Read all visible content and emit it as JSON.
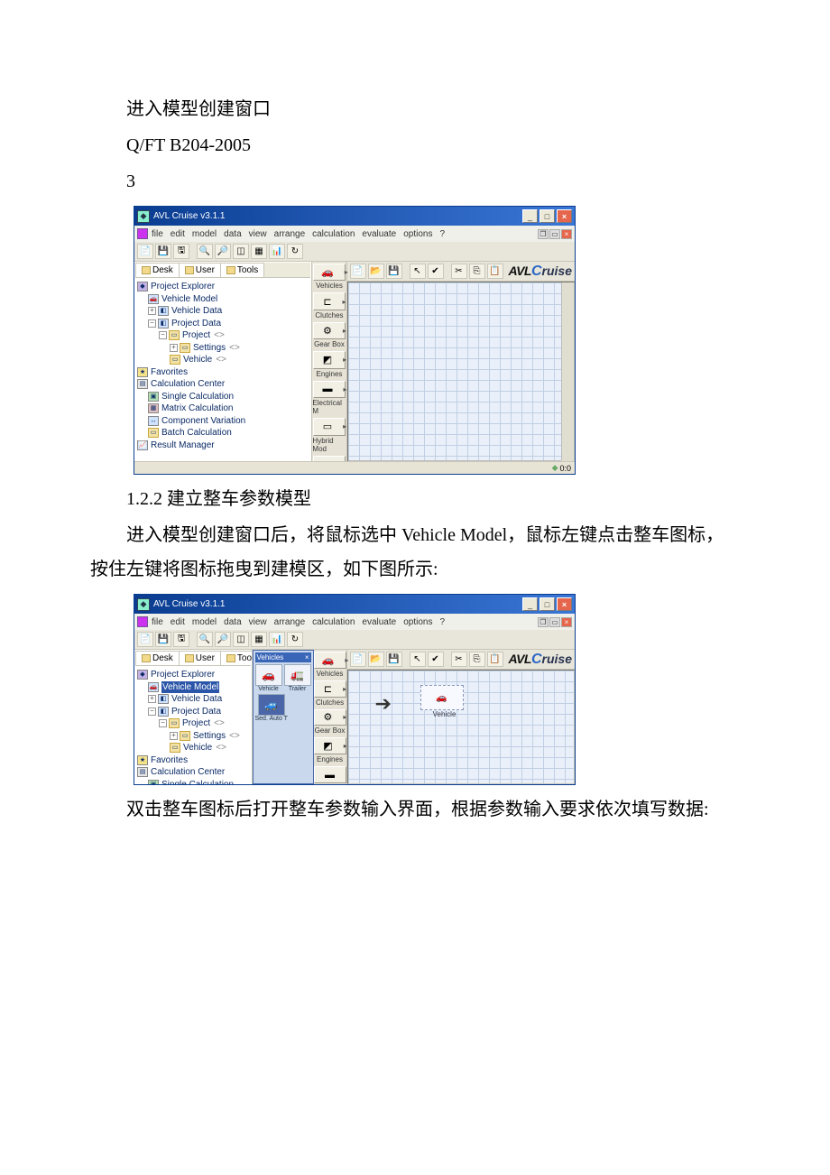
{
  "para1": "进入模型创建窗口",
  "para2": "Q/FT B204-2005",
  "para3": "3",
  "para4": "1.2.2 建立整车参数模型",
  "para5": "进入模型创建窗口后，将鼠标选中 Vehicle Model，鼠标左键点击整车图标，按住左键将图标拖曳到建模区，如下图所示:",
  "para6": "双击整车图标后打开整车参数输入界面，根据参数输入要求依次填写数据:",
  "sc1": {
    "title": "AVL Cruise v3.1.1",
    "menu": [
      "file",
      "edit",
      "model",
      "data",
      "view",
      "arrange",
      "calculation",
      "evaluate",
      "options",
      "?"
    ],
    "tabs": [
      "Desk",
      "User",
      "Tools"
    ],
    "tree": {
      "root": "Project Explorer",
      "vehicle_model": "Vehicle Model",
      "vehicle_data": "Vehicle Data",
      "project_data": "Project Data",
      "project": "Project",
      "settings": "Settings",
      "vehicle": "Vehicle",
      "favorites": "Favorites",
      "calc_center": "Calculation Center",
      "single_calc": "Single Calculation",
      "matrix_calc": "Matrix Calculation",
      "comp_var": "Component Variation",
      "batch_calc": "Batch Calculation",
      "result_mgr": "Result Manager"
    },
    "palette": [
      "Vehicles",
      "Clutches",
      "Gear Box",
      "Engines",
      "Electrical M",
      "Hybrid Mod"
    ],
    "logo": {
      "avl": "AVL",
      "c": "C",
      "ruise": "ruise"
    },
    "status_coord": "0:0"
  },
  "sc2": {
    "popup": {
      "title": "Vehicles",
      "items": [
        "Vehicle",
        "Trailer",
        "Sed. Auto T"
      ]
    },
    "drop_label": "Vehicle"
  }
}
